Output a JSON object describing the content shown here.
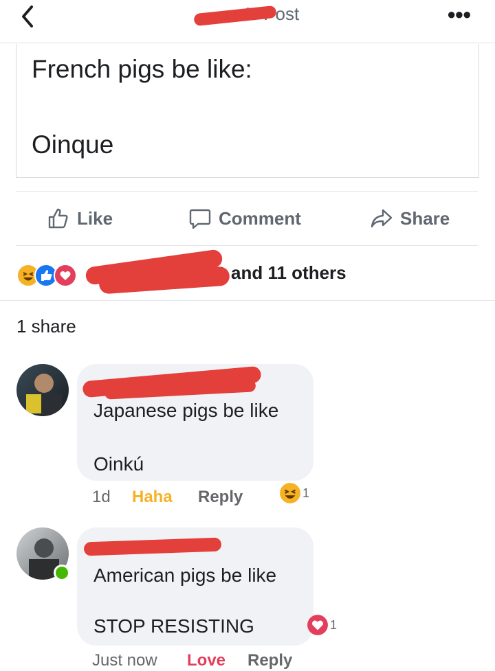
{
  "header": {
    "title": "'s Post"
  },
  "post": {
    "line1": "French pigs be like:",
    "line2": "Oinque"
  },
  "actions": {
    "like": "Like",
    "comment": "Comment",
    "share": "Share"
  },
  "reactions": {
    "summary": "and 11 others"
  },
  "shares": "1 share",
  "comments": [
    {
      "line1": "Japanese pigs be like",
      "line2": "Oinkú",
      "time": "1d",
      "reaction_label": "Haha",
      "reply": "Reply",
      "reaction_count": "1"
    },
    {
      "line1": "American pigs be like",
      "line2": "STOP RESISTING",
      "time": "Just now",
      "reaction_label": "Love",
      "reply": "Reply",
      "reaction_count": "1"
    }
  ],
  "colors": {
    "haha": "#f7b125",
    "love": "#e33f5c",
    "like": "#1877f2",
    "redaction": "#e33f3b"
  }
}
